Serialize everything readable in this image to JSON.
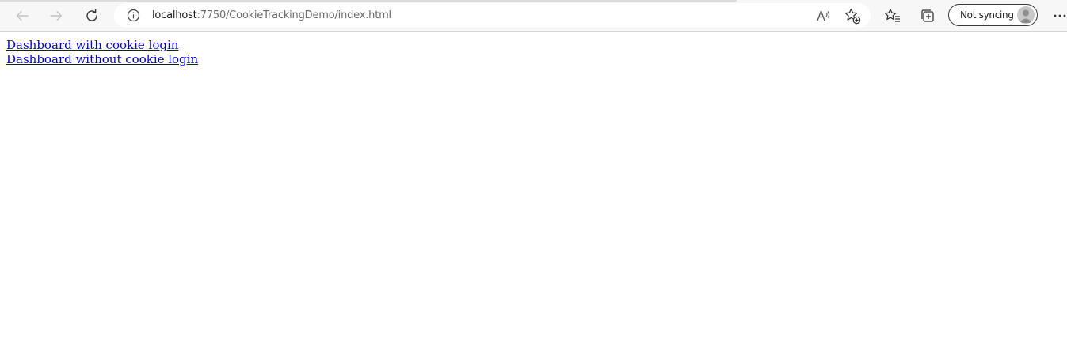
{
  "browser": {
    "address": {
      "host": "localhost",
      "path": ":7750/CookieTrackingDemo/index.html"
    },
    "profile": {
      "label": "Not syncing"
    },
    "icons": {
      "back": "back-arrow-icon",
      "forward": "forward-arrow-icon",
      "refresh": "refresh-icon",
      "site_info": "info-icon",
      "read_aloud": "read-aloud-icon",
      "add_favorite": "add-favorite-icon",
      "favorites": "favorites-icon",
      "collections": "collections-icon",
      "avatar": "avatar-icon",
      "more": "more-icon"
    }
  },
  "page": {
    "links": [
      "Dashboard with cookie login",
      "Dashboard without cookie login"
    ]
  },
  "colors": {
    "link": "#0000ee",
    "toolbar_bg": "#f7f7f7",
    "address_bg": "#ffffff"
  }
}
